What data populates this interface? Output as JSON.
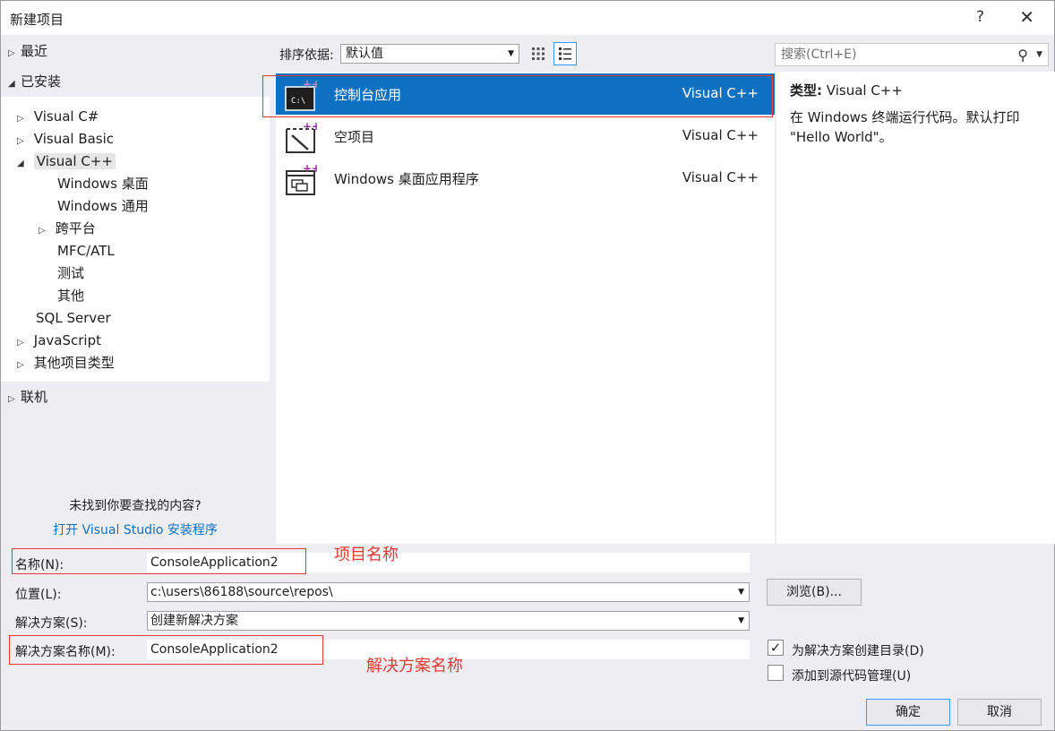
{
  "window": {
    "title": "新建项目",
    "help_glyph": "?",
    "close_glyph": "✕"
  },
  "left": {
    "recent": "最近",
    "installed": "已安装",
    "tree": {
      "vcsharp": "Visual C#",
      "vbasic": "Visual Basic",
      "vcpp": "Visual C++",
      "windesktop": "Windows 桌面",
      "winuniversal": "Windows 通用",
      "crossplat": "跨平台",
      "mfcatl": "MFC/ATL",
      "test": "测试",
      "other": "其他",
      "sqlserver": "SQL Server",
      "javascript": "JavaScript",
      "otherprojects": "其他项目类型"
    },
    "online": "联机",
    "notfound": "未找到你要查找的内容?",
    "open_installer": "打开 Visual Studio 安装程序"
  },
  "toolbar": {
    "sort_label": "排序依据:",
    "sort_value": "默认值",
    "search_placeholder": "搜索(Ctrl+E)"
  },
  "templates": [
    {
      "name": "控制台应用",
      "lang": "Visual C++",
      "icon": "console-app-icon",
      "selected": true
    },
    {
      "name": "空项目",
      "lang": "Visual C++",
      "icon": "empty-project-icon",
      "selected": false
    },
    {
      "name": "Windows 桌面应用程序",
      "lang": "Visual C++",
      "icon": "windows-desktop-app-icon",
      "selected": false
    }
  ],
  "description": {
    "type_label": "类型:",
    "type_value": "Visual C++",
    "text": "在 Windows 终端运行代码。默认打印 \"Hello World\"。"
  },
  "form": {
    "name_label": "名称(N):",
    "name_value": "ConsoleApplication2",
    "location_label": "位置(L):",
    "location_value": "c:\\users\\86188\\source\\repos\\",
    "solution_label": "解决方案(S):",
    "solution_value": "创建新解决方案",
    "solution_name_label": "解决方案名称(M):",
    "solution_name_value": "ConsoleApplication2",
    "browse": "浏览(B)...",
    "create_dir_label": "为解决方案创建目录(D)",
    "create_dir_checked": true,
    "source_control_label": "添加到源代码管理(U)",
    "source_control_checked": false,
    "ok": "确定",
    "cancel": "取消"
  },
  "annotations": {
    "project_name": "项目名称",
    "solution_name": "解决方案名称"
  },
  "colors": {
    "selection": "#0e70c0",
    "link": "#0e70c0",
    "annotation": "#e53935"
  }
}
